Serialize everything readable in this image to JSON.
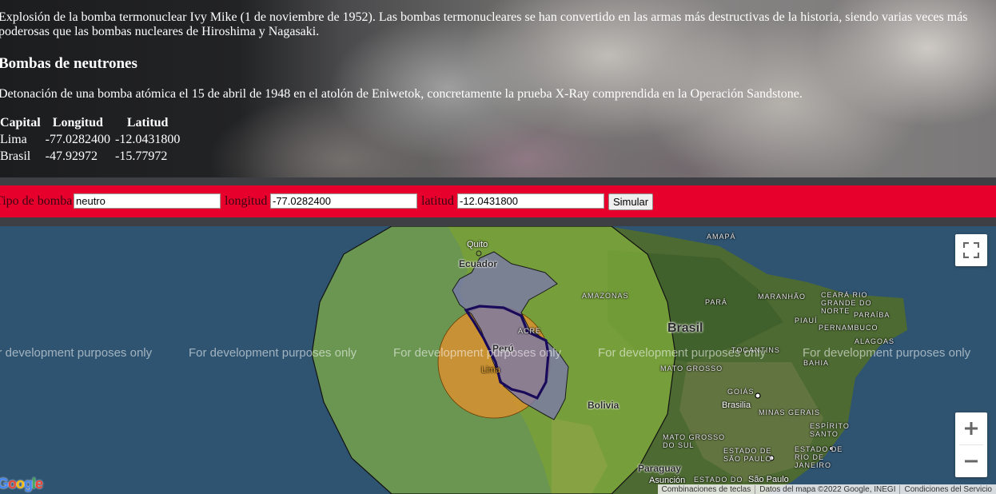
{
  "hero": {
    "description_1": "Explosión de la bomba termonuclear Ivy Mike (1 de noviembre de 1952). Las bombas termonucleares se han convertido en las armas más destructivas de la historia, siendo varias veces más poderosas que las bombas nucleares de Hiroshima y Nagasaki.",
    "heading": "Bombas de neutrones",
    "description_2": "Detonación de una bomba atómica el 15 de abril de 1948 en el atolón de Eniwetok, concretamente la prueba X-Ray comprendida en la Operación Sandstone."
  },
  "table": {
    "headers": [
      "Capital",
      "Longitud",
      "Latitud"
    ],
    "rows": [
      [
        "Lima",
        "-77.0282400",
        "-12.0431800"
      ],
      [
        "Brasil",
        "-47.92972",
        "-15.77972"
      ]
    ]
  },
  "controls": {
    "bomb_type_label": "Tipo de bomba",
    "bomb_type_value": "neutro",
    "longitude_label": "longitud",
    "longitude_value": "-77.0282400",
    "latitude_label": "latitud",
    "latitude_value": "-12.0431800",
    "simulate_label": "Simular"
  },
  "map": {
    "watermark": "For development purposes only",
    "labels": {
      "quito": "Quito",
      "ecuador": "Ecuador",
      "peru": "Perú",
      "lima": "Lima",
      "bolivia": "Bolivia",
      "brasil": "Brasil",
      "amazonas": "AMAZONAS",
      "acre": "ACRE",
      "amapa": "AMAPÁ",
      "para": "PARÁ",
      "maranhao": "MARANHÃO",
      "ceara": "CEARÁ",
      "rio_grande_do_norte": "RIO GRANDE DO NORTE",
      "paraiba": "PARAÍBA",
      "piaui": "PIAUÍ",
      "pernambuco": "PERNAMBUCO",
      "alagoas": "ALAGOAS",
      "bahia": "BAHIA",
      "tocantins": "TOCANTINS",
      "mato_grosso": "MATO GROSSO",
      "goias": "GOIÁS",
      "brasilia": "Brasilia",
      "minas_gerais": "MINAS GERAIS",
      "espirito_santo": "ESPÍRITO SANTO",
      "mato_grosso_do_sul": "MATO GROSSO DO SUL",
      "rio_de_janeiro": "ESTADO DE RIO DE JANEIRO",
      "sao_paulo_state": "ESTADO DE SÃO PAULO",
      "sao_paulo": "São Paulo",
      "paraguay": "Paraguay",
      "asuncion": "Asunción",
      "estado_do": "ESTADO DO"
    },
    "attribution": [
      "Combinaciones de teclas",
      "Datos del mapa ©2022 Google, INEGI",
      "Condiciones del Servicio"
    ],
    "google_logo": "Google",
    "colors": {
      "large_blast_fill": "#7fb04a",
      "small_blast_fill": "#d98a30",
      "peru_fill": "#7b78a8",
      "peru_outline": "#1a0a5a",
      "control_bar": "#e8002d"
    }
  }
}
